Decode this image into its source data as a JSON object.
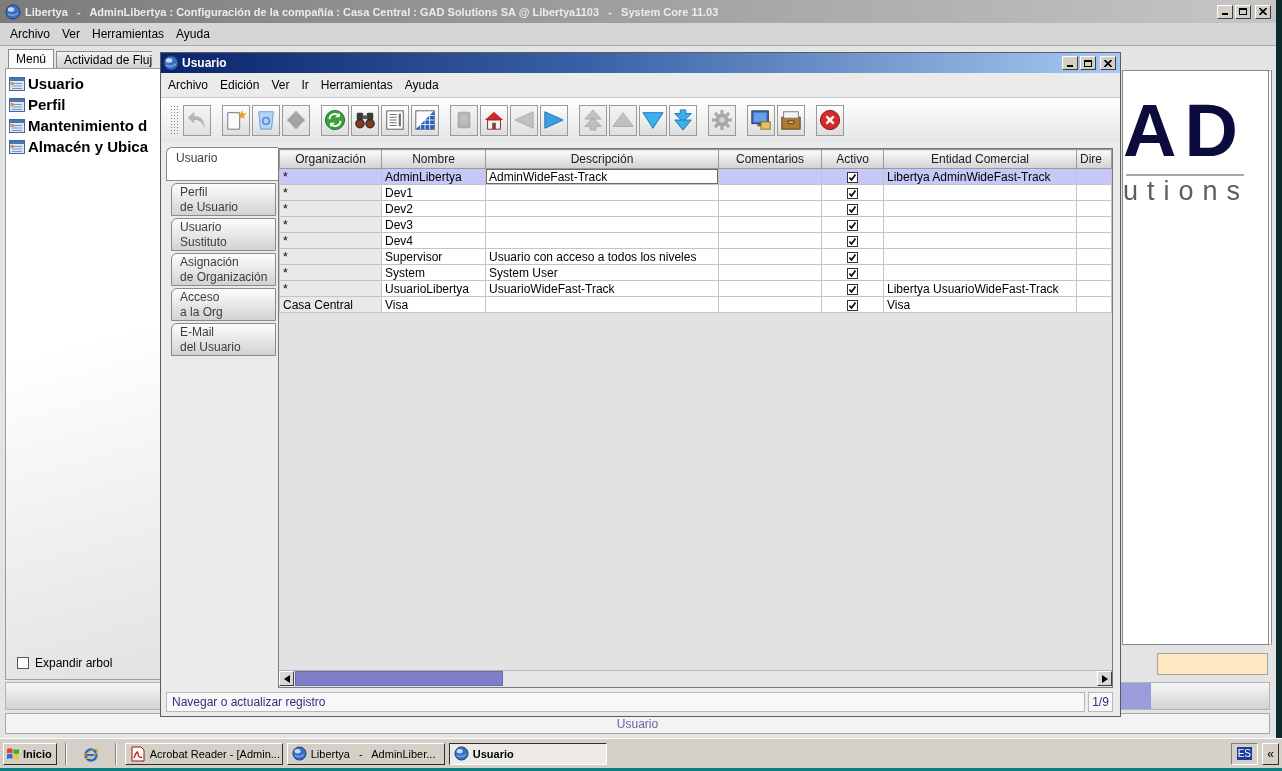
{
  "main_window": {
    "title": "Libertya   -   AdminLibertya : Configuración de la compañía : Casa Central : GAD Solutions SA @ Libertya1103   -   System Core 11.03",
    "menu": [
      "Archivo",
      "Ver",
      "Herramientas",
      "Ayuda"
    ],
    "tabs": [
      {
        "label": "Menú",
        "selected": true
      },
      {
        "label": "Actividad de Fluj",
        "selected": false
      }
    ],
    "tree": [
      "Usuario",
      "Perfil",
      "Mantenimiento d",
      "Almacén y Ubica"
    ],
    "expand_tree": {
      "label": "Expandir arbol",
      "checked": false
    },
    "logo": {
      "mark": "AD",
      "tagline": "utions"
    },
    "footer": "Usuario"
  },
  "user_window": {
    "title": "Usuario",
    "menu": [
      "Archivo",
      "Edición",
      "Ver",
      "Ir",
      "Herramientas",
      "Ayuda"
    ],
    "toolbar": [
      {
        "buttons": [
          {
            "kind": "undo",
            "disabled": true
          }
        ]
      },
      {
        "buttons": [
          {
            "kind": "new",
            "disabled": false
          },
          {
            "kind": "save",
            "disabled": false
          },
          {
            "kind": "delete",
            "disabled": true
          }
        ]
      },
      {
        "buttons": [
          {
            "kind": "refresh",
            "disabled": false
          },
          {
            "kind": "find",
            "disabled": false
          },
          {
            "kind": "attachment",
            "disabled": false
          },
          {
            "kind": "grid",
            "disabled": false
          }
        ]
      },
      {
        "buttons": [
          {
            "kind": "parent",
            "disabled": true
          },
          {
            "kind": "home",
            "disabled": false
          },
          {
            "kind": "back",
            "disabled": true
          },
          {
            "kind": "forward",
            "disabled": false
          }
        ]
      },
      {
        "buttons": [
          {
            "kind": "first",
            "disabled": true
          },
          {
            "kind": "previous",
            "disabled": true
          },
          {
            "kind": "next",
            "disabled": false
          },
          {
            "kind": "last",
            "disabled": false
          }
        ]
      },
      {
        "buttons": [
          {
            "kind": "history",
            "disabled": true
          }
        ]
      },
      {
        "buttons": [
          {
            "kind": "report",
            "disabled": false
          },
          {
            "kind": "archive",
            "disabled": false
          }
        ]
      },
      {
        "buttons": [
          {
            "kind": "exit",
            "disabled": false
          }
        ]
      }
    ],
    "tabs": [
      {
        "label": "Usuario",
        "selected": true
      },
      {
        "label": "Perfil\nde Usuario",
        "selected": false
      },
      {
        "label": "Usuario\nSustituto",
        "selected": false
      },
      {
        "label": "Asignación\nde Organización",
        "selected": false
      },
      {
        "label": "Acceso\na la Org",
        "selected": false
      },
      {
        "label": "E-Mail\ndel Usuario",
        "selected": false
      }
    ],
    "table": {
      "columns": [
        "Organización",
        "Nombre",
        "Descripción",
        "Comentarios",
        "Activo",
        "Entidad Comercial",
        "Dire"
      ],
      "rows": [
        {
          "organization": "*",
          "name": "AdminLibertya",
          "description": "AdminWideFast-Track",
          "active": true,
          "business_partner": "Libertya AdminWideFast-Track",
          "selected": true
        },
        {
          "organization": "*",
          "name": "Dev1",
          "active": true,
          "selected": false
        },
        {
          "organization": "*",
          "name": "Dev2",
          "active": true,
          "selected": false
        },
        {
          "organization": "*",
          "name": "Dev3",
          "active": true,
          "selected": false
        },
        {
          "organization": "*",
          "name": "Dev4",
          "active": true,
          "selected": false
        },
        {
          "organization": "*",
          "name": "Supervisor",
          "description": "Usuario con acceso a todos los niveles",
          "active": true,
          "selected": false
        },
        {
          "organization": "*",
          "name": "System",
          "description": "System User",
          "active": true,
          "selected": false
        },
        {
          "organization": "*",
          "name": "UsuarioLibertya",
          "description": "UsuarioWideFast-Track",
          "active": true,
          "business_partner": "Libertya UsuarioWideFast-Track",
          "selected": false
        },
        {
          "organization": "Casa Central",
          "name": "Visa",
          "active": true,
          "business_partner": "Visa",
          "selected": false
        }
      ]
    },
    "status": "Navegar o actualizar registro",
    "record": "1/9"
  },
  "taskbar": {
    "start": "Inicio",
    "tasks": [
      {
        "kind": "pdf",
        "label": "Acrobat Reader - [Admin...",
        "selected": false
      },
      {
        "kind": "app",
        "label": "Libertya   -   AdminLiber...",
        "selected": false
      },
      {
        "kind": "app",
        "label": "Usuario",
        "selected": true
      }
    ],
    "language": "ES",
    "tray_toggle": "«"
  }
}
